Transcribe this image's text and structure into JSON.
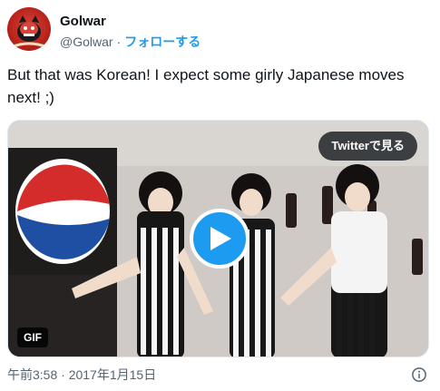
{
  "author": {
    "display_name": "Golwar",
    "handle": "@Golwar",
    "separator": "·",
    "follow_label": "フォローする"
  },
  "tweet": {
    "text": "But that was Korean! I expect some girly Japanese moves next! ;)"
  },
  "media": {
    "watch_label": "Twitterで見る",
    "badge": "GIF",
    "play_icon": "play-icon"
  },
  "footer": {
    "timestamp": "午前3:58 · 2017年1月15日",
    "info_icon": "info-icon"
  },
  "colors": {
    "accent": "#1d9bf0",
    "text": "#0f1419",
    "secondary": "#536471"
  }
}
